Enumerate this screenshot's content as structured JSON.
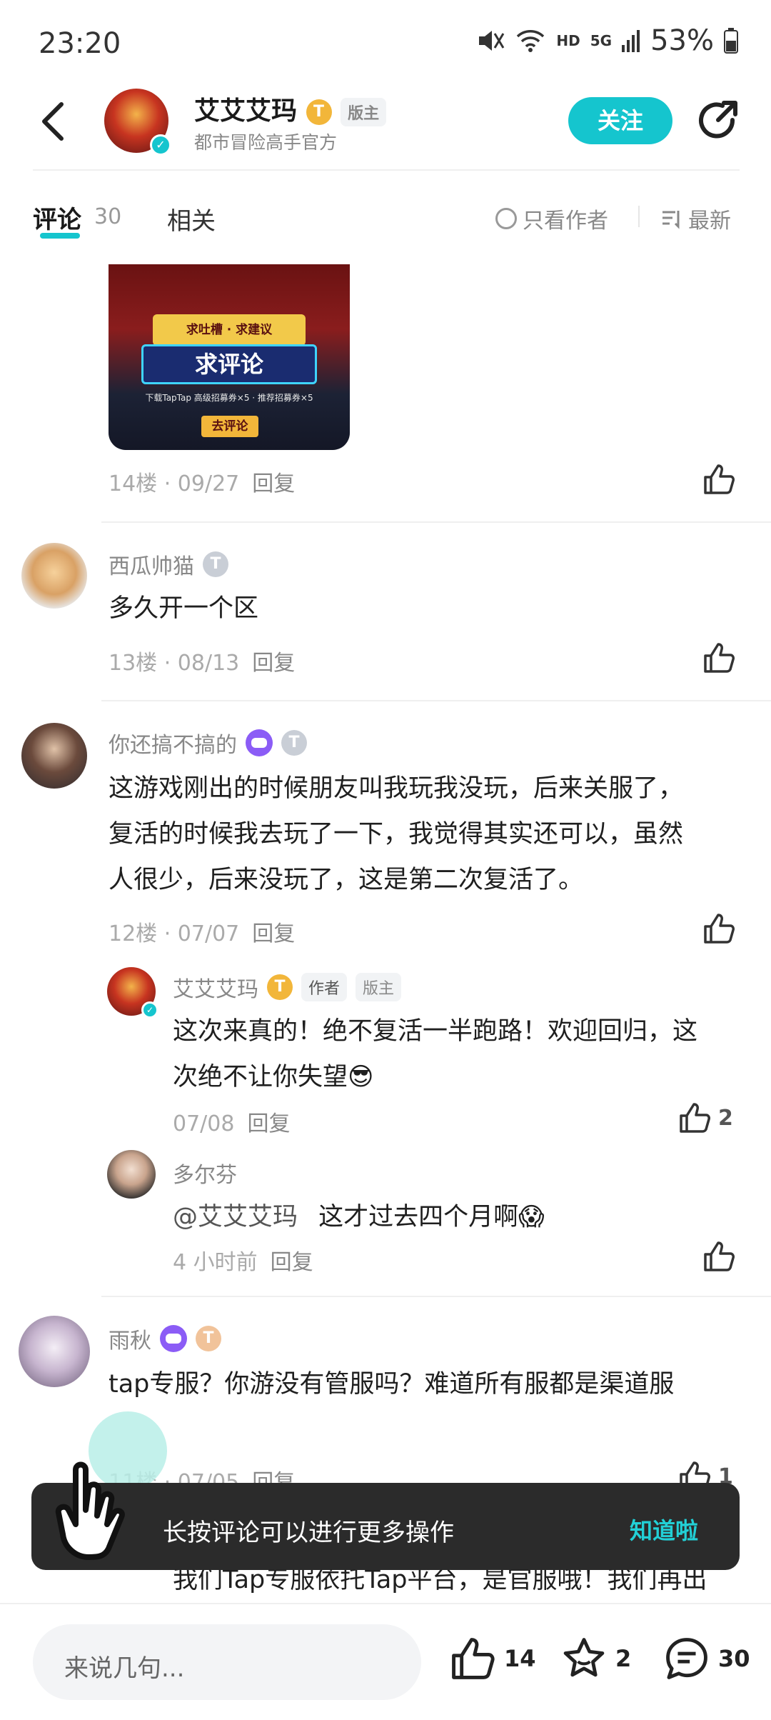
{
  "status_bar": {
    "time": "23:20",
    "network": "HD",
    "signal": "5G",
    "battery": "53%"
  },
  "header": {
    "name": "艾艾艾玛",
    "badge_letter": "T",
    "role": "版主",
    "subtitle": "都市冒险高手官方",
    "follow_label": "关注"
  },
  "tabs": {
    "comments_label": "评论",
    "comments_count": "30",
    "related_label": "相关",
    "only_author_label": "只看作者",
    "sort_label": "最新"
  },
  "image_post": {
    "banner_top": "求吐槽 · 求建议",
    "banner_main": "求评论",
    "detail_line": "下载TapTap 高级招募券×5 · 推荐招募券×5",
    "cta": "去评论",
    "meta": "14楼 · 09/27",
    "reply": "回复"
  },
  "comments": [
    {
      "user": "西瓜帅猫",
      "text": "多久开一个区",
      "meta": "13楼 · 08/13",
      "reply": "回复"
    },
    {
      "user": "你还搞不搞的",
      "lines": [
        "这游戏刚出的时候朋友叫我玩我没玩，后来关服了，",
        "复活的时候我去玩了一下，我觉得其实还可以，虽然",
        "人很少，后来没玩了，这是第二次复活了。"
      ],
      "meta": "12楼 · 07/07",
      "reply": "回复"
    },
    {
      "user": "雨秋",
      "text": "tap专服？你游没有管服吗？难道所有服都是渠道服",
      "meta": "11楼 · 07/05",
      "reply": "回复",
      "likes": "1"
    }
  ],
  "replies": [
    {
      "user": "艾艾艾玛",
      "tag_author": "作者",
      "tag_role": "版主",
      "lines": [
        "这次来真的！绝不复活一半跑路！欢迎回归，这",
        "次绝不让你失望😎"
      ],
      "meta": "07/08",
      "reply": "回复",
      "likes": "2"
    },
    {
      "user": "多尔芬",
      "mention": "@艾艾艾玛",
      "text": "这才过去四个月啊😱",
      "meta": "4 小时前",
      "reply": "回复"
    },
    {
      "partial_text": "我们Tap专服依托Tap平台，是官服哦！我们再出"
    }
  ],
  "toast": {
    "text": "长按评论可以进行更多操作",
    "button": "知道啦"
  },
  "bottom_bar": {
    "placeholder": "来说几句...",
    "likes": "14",
    "favorites": "2",
    "comments": "30"
  },
  "colors": {
    "accent": "#15c5ce",
    "badge_gold": "#f2b63a",
    "toast_bg": "#2b2b2b"
  }
}
